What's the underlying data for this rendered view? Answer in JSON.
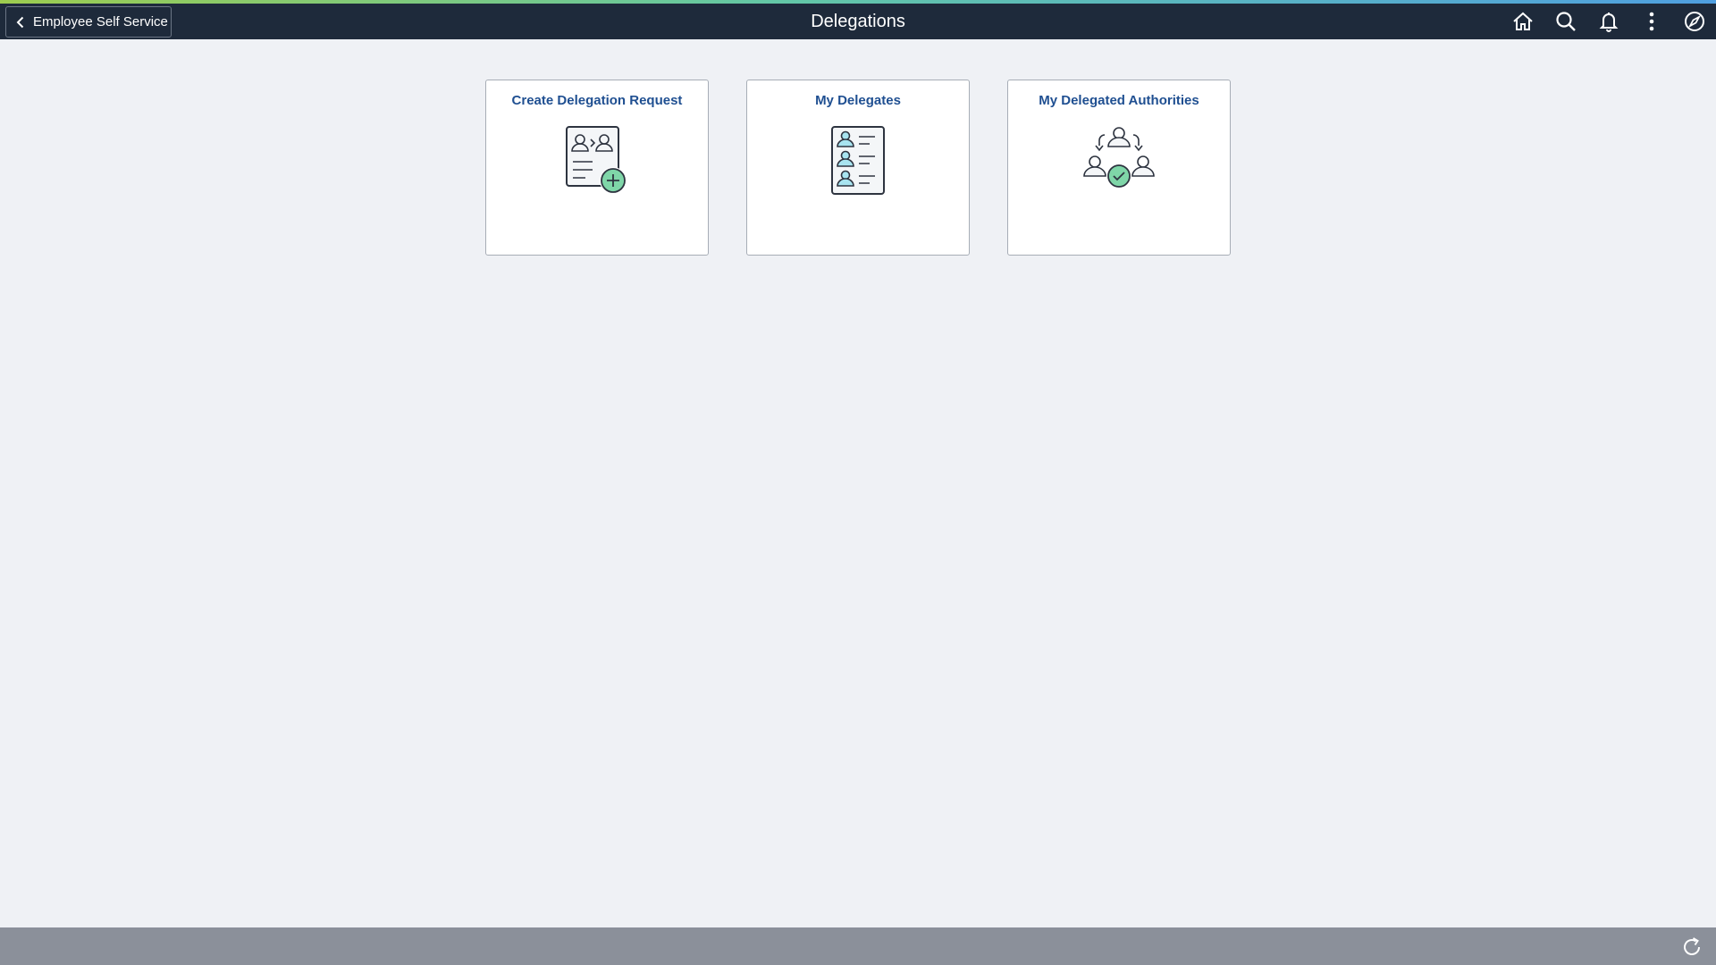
{
  "header": {
    "back_label": "Employee Self Service",
    "title": "Delegations",
    "actions": [
      {
        "name": "home-icon"
      },
      {
        "name": "search-icon"
      },
      {
        "name": "bell-icon"
      },
      {
        "name": "more-vertical-icon"
      },
      {
        "name": "compass-icon"
      }
    ]
  },
  "tiles": [
    {
      "title": "Create Delegation Request",
      "icon": "delegation-request-add-icon"
    },
    {
      "title": "My Delegates",
      "icon": "delegates-list-icon"
    },
    {
      "title": "My Delegated Authorities",
      "icon": "delegated-authorities-icon"
    }
  ],
  "footer": {
    "icon": "refresh-icon"
  },
  "colors": {
    "header_bg": "#1e2a3b",
    "page_bg": "#eff1f5",
    "tile_title": "#1f4f91",
    "accent_green": "#7fd6a8",
    "footer_bg": "#8b909a"
  }
}
